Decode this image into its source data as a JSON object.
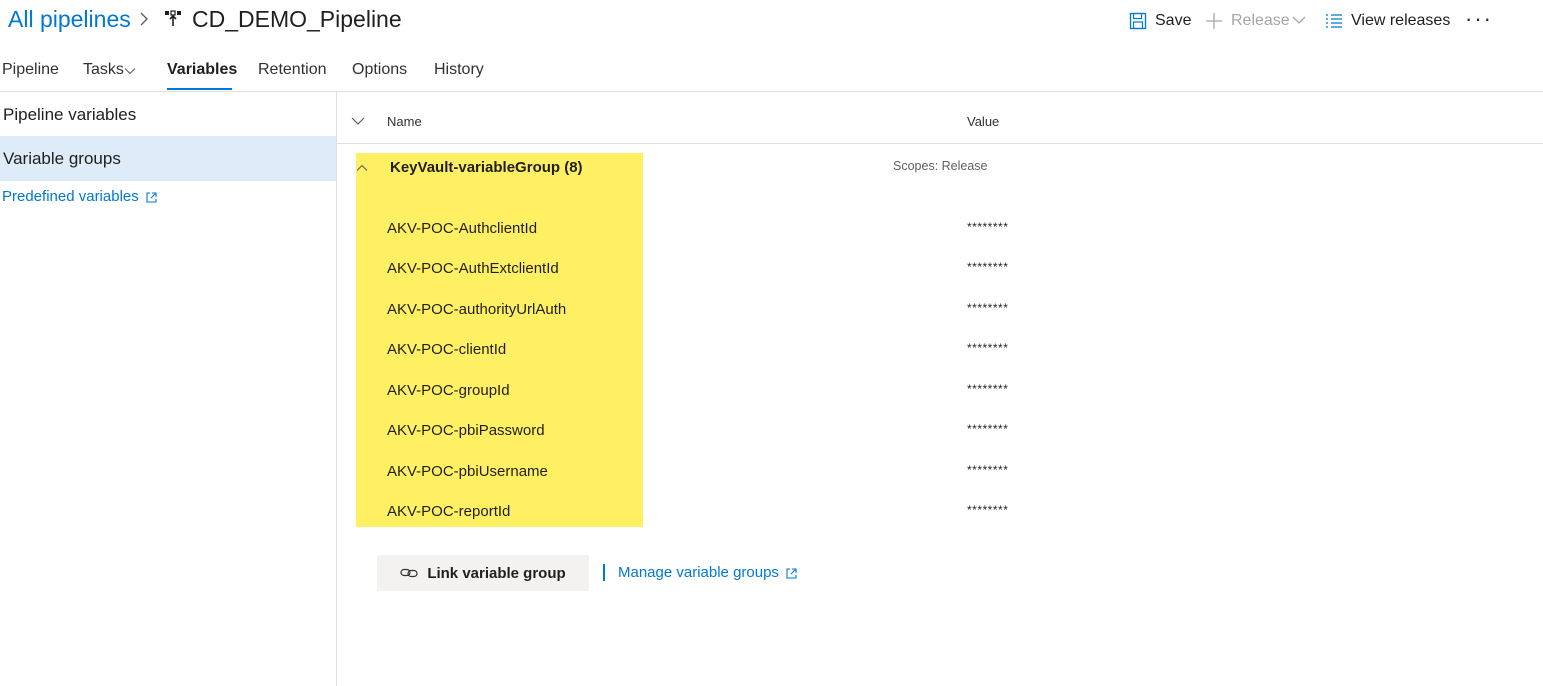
{
  "header": {
    "breadcrumb_root": "All pipelines",
    "title": "CD_DEMO_Pipeline",
    "toolbar": {
      "save_label": "Save",
      "release_label": "Release",
      "view_releases_label": "View releases",
      "more_label": "···"
    }
  },
  "tabs": [
    {
      "label": "Pipeline"
    },
    {
      "label": "Tasks"
    },
    {
      "label": "Variables",
      "active": true
    },
    {
      "label": "Retention"
    },
    {
      "label": "Options"
    },
    {
      "label": "History"
    }
  ],
  "sidebar": {
    "items": [
      {
        "label": "Pipeline variables"
      },
      {
        "label": "Variable groups",
        "selected": true
      }
    ],
    "predefined_link": "Predefined variables"
  },
  "table": {
    "columns": {
      "name": "Name",
      "value": "Value"
    },
    "group": {
      "name": "KeyVault-variableGroup (8)",
      "scope": "Scopes: Release",
      "variables": [
        {
          "name": "AKV-POC-AuthclientId",
          "value": "********"
        },
        {
          "name": "AKV-POC-AuthExtclientId",
          "value": "********"
        },
        {
          "name": "AKV-POC-authorityUrlAuth",
          "value": "********"
        },
        {
          "name": "AKV-POC-clientId",
          "value": "********"
        },
        {
          "name": "AKV-POC-groupId",
          "value": "********"
        },
        {
          "name": "AKV-POC-pbiPassword",
          "value": "********"
        },
        {
          "name": "AKV-POC-pbiUsername",
          "value": "********"
        },
        {
          "name": "AKV-POC-reportId",
          "value": "********"
        }
      ]
    }
  },
  "actions": {
    "link_group_label": "Link variable group",
    "manage_groups_label": "Manage variable groups"
  },
  "colors": {
    "accent": "#0078d4",
    "highlight": "#fff063",
    "selected_bg": "#deecf9"
  },
  "icons": {
    "pipeline": "release-pipeline-icon",
    "save": "save-icon",
    "release": "plus-icon",
    "view_releases": "list-icon",
    "link": "link-icon",
    "external": "external-link-icon"
  }
}
